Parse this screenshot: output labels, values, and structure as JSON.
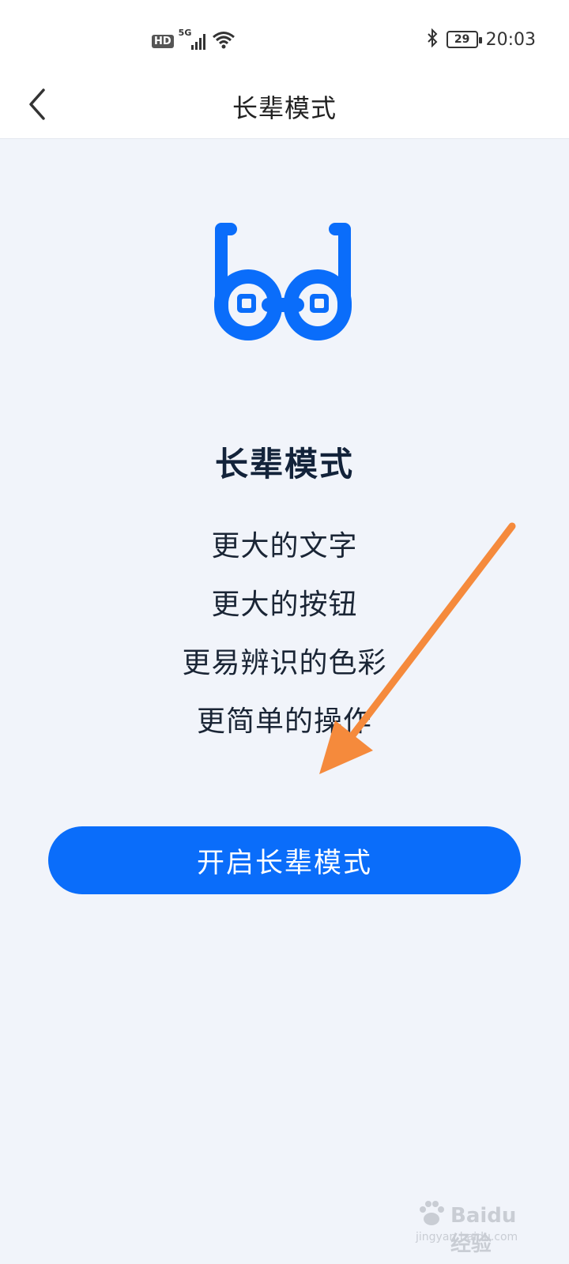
{
  "status_bar": {
    "hd_label": "HD",
    "network_label": "5G",
    "battery_level": "29",
    "time": "20:03",
    "icons": [
      "signal-icon",
      "wifi-icon",
      "bluetooth-icon",
      "battery-icon"
    ]
  },
  "nav": {
    "title": "长辈模式",
    "back_icon": "chevron-left-icon"
  },
  "hero": {
    "icon": "glasses-icon",
    "title": "长辈模式",
    "features": [
      "更大的文字",
      "更大的按钮",
      "更易辨识的色彩",
      "更简单的操作"
    ]
  },
  "actions": {
    "enable_label": "开启长辈模式"
  },
  "annotation": {
    "arrow_icon": "pointer-arrow-icon",
    "arrow_color": "#f58a3c"
  },
  "watermark": {
    "brand": "Baidu经验",
    "url": "jingyan.baidu.com"
  },
  "colors": {
    "accent": "#0a6dfa",
    "background": "#f1f4fa"
  }
}
